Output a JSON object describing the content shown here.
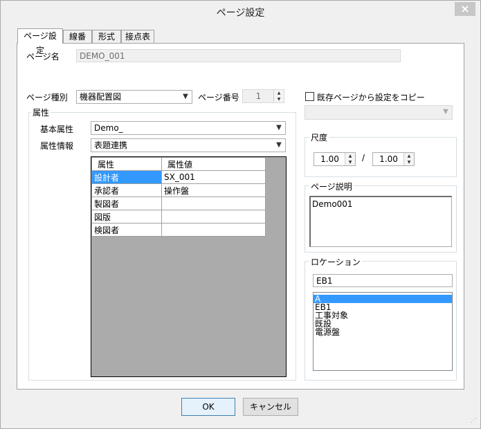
{
  "window": {
    "title": "ページ設定",
    "close_label": "×"
  },
  "tabs": [
    {
      "label": "ページ設定"
    },
    {
      "label": "線番"
    },
    {
      "label": "形式"
    },
    {
      "label": "接点表"
    }
  ],
  "page_name": {
    "label": "ページ名",
    "value": "DEMO_001"
  },
  "page_type": {
    "label": "ページ種別",
    "value": "機器配置図"
  },
  "page_number": {
    "label": "ページ番号",
    "value": "1"
  },
  "copy_existing": {
    "label": "既存ページから設定をコピー",
    "checked": false,
    "value": ""
  },
  "attributes": {
    "group_label": "属性",
    "base_label": "基本属性",
    "base_value": "Demo_",
    "info_label": "属性情報",
    "info_value": "表題連携",
    "columns": [
      "属性",
      "属性値"
    ],
    "rows": [
      {
        "name": "設計者",
        "value": "SX_001",
        "selected": true
      },
      {
        "name": "承認者",
        "value": "操作盤",
        "selected": false
      },
      {
        "name": "製図者",
        "value": "",
        "selected": false
      },
      {
        "name": "図版",
        "value": "",
        "selected": false
      },
      {
        "name": "検図者",
        "value": "",
        "selected": false
      }
    ]
  },
  "scale": {
    "label": "尺度",
    "numerator": "1.00",
    "separator": "/",
    "denominator": "1.00"
  },
  "page_description": {
    "label": "ページ説明",
    "value": "Demo001"
  },
  "location": {
    "label": "ロケーション",
    "value": "EB1",
    "items": [
      {
        "label": "A",
        "selected": true
      },
      {
        "label": "EB1",
        "selected": false
      },
      {
        "label": "工事対象",
        "selected": false
      },
      {
        "label": "既設",
        "selected": false
      },
      {
        "label": "電源盤",
        "selected": false
      }
    ]
  },
  "buttons": {
    "ok": "OK",
    "cancel": "キャンセル"
  },
  "colors": {
    "selection": "#3399ff",
    "grid_background": "#ababab"
  }
}
